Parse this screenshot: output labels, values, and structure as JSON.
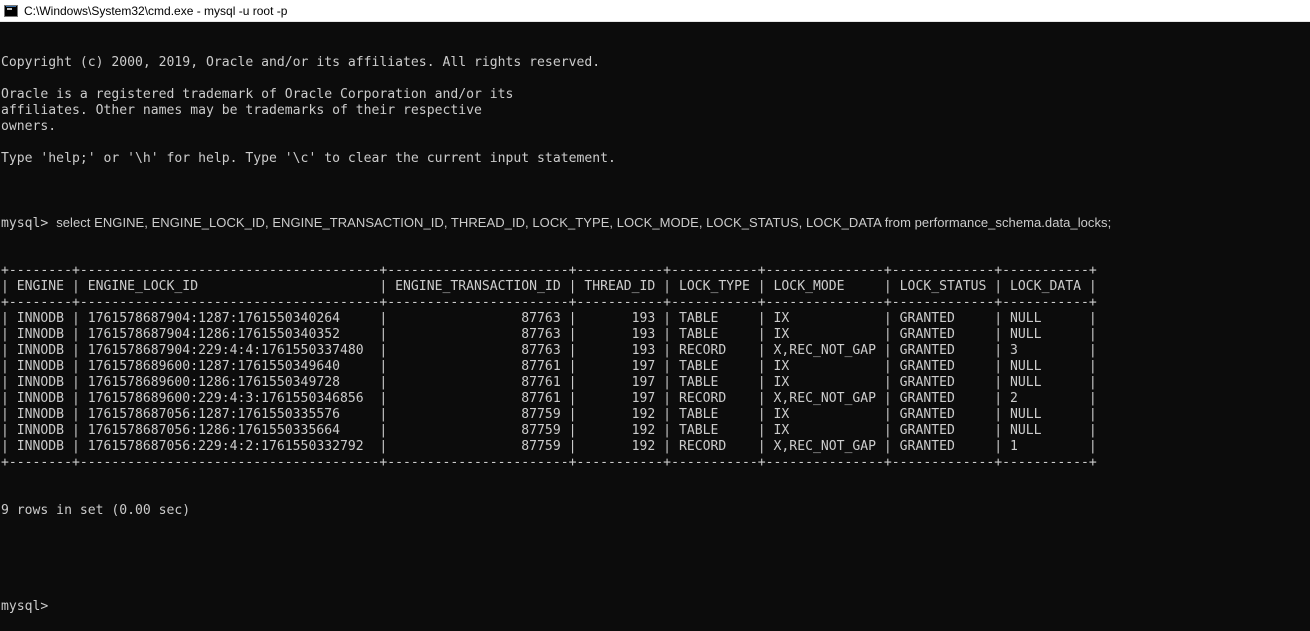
{
  "window": {
    "title": "C:\\Windows\\System32\\cmd.exe - mysql  -u root -p",
    "icon": "cmd-icon"
  },
  "console": {
    "banner": [
      "Copyright (c) 2000, 2019, Oracle and/or its affiliates. All rights reserved.",
      "",
      "Oracle is a registered trademark of Oracle Corporation and/or its",
      "affiliates. Other names may be trademarks of their respective",
      "owners.",
      "",
      "Type 'help;' or '\\h' for help. Type '\\c' to clear the current input statement.",
      ""
    ],
    "prompt": "mysql>",
    "query": "select ENGINE, ENGINE_LOCK_ID, ENGINE_TRANSACTION_ID, THREAD_ID, LOCK_TYPE, LOCK_MODE, LOCK_STATUS, LOCK_DATA from performance_schema.data_locks;",
    "table_lines": [
      "+--------+--------------------------------------+-----------------------+-----------+-----------+---------------+-------------+-----------+",
      "| ENGINE | ENGINE_LOCK_ID                       | ENGINE_TRANSACTION_ID | THREAD_ID | LOCK_TYPE | LOCK_MODE     | LOCK_STATUS | LOCK_DATA |",
      "+--------+--------------------------------------+-----------------------+-----------+-----------+---------------+-------------+-----------+",
      "| INNODB | 1761578687904:1287:1761550340264     |                 87763 |       193 | TABLE     | IX            | GRANTED     | NULL      |",
      "| INNODB | 1761578687904:1286:1761550340352     |                 87763 |       193 | TABLE     | IX            | GRANTED     | NULL      |",
      "| INNODB | 1761578687904:229:4:4:1761550337480  |                 87763 |       193 | RECORD    | X,REC_NOT_GAP | GRANTED     | 3         |",
      "| INNODB | 1761578689600:1287:1761550349640     |                 87761 |       197 | TABLE     | IX            | GRANTED     | NULL      |",
      "| INNODB | 1761578689600:1286:1761550349728     |                 87761 |       197 | TABLE     | IX            | GRANTED     | NULL      |",
      "| INNODB | 1761578689600:229:4:3:1761550346856  |                 87761 |       197 | RECORD    | X,REC_NOT_GAP | GRANTED     | 2         |",
      "| INNODB | 1761578687056:1287:1761550335576     |                 87759 |       192 | TABLE     | IX            | GRANTED     | NULL      |",
      "| INNODB | 1761578687056:1286:1761550335664     |                 87759 |       192 | TABLE     | IX            | GRANTED     | NULL      |",
      "| INNODB | 1761578687056:229:4:2:1761550332792  |                 87759 |       192 | RECORD    | X,REC_NOT_GAP | GRANTED     | 1         |",
      "+--------+--------------------------------------+-----------------------+-----------+-----------+---------------+-------------+-----------+"
    ],
    "result_summary": "9 rows in set (0.00 sec)",
    "final_prompt": "mysql>"
  }
}
